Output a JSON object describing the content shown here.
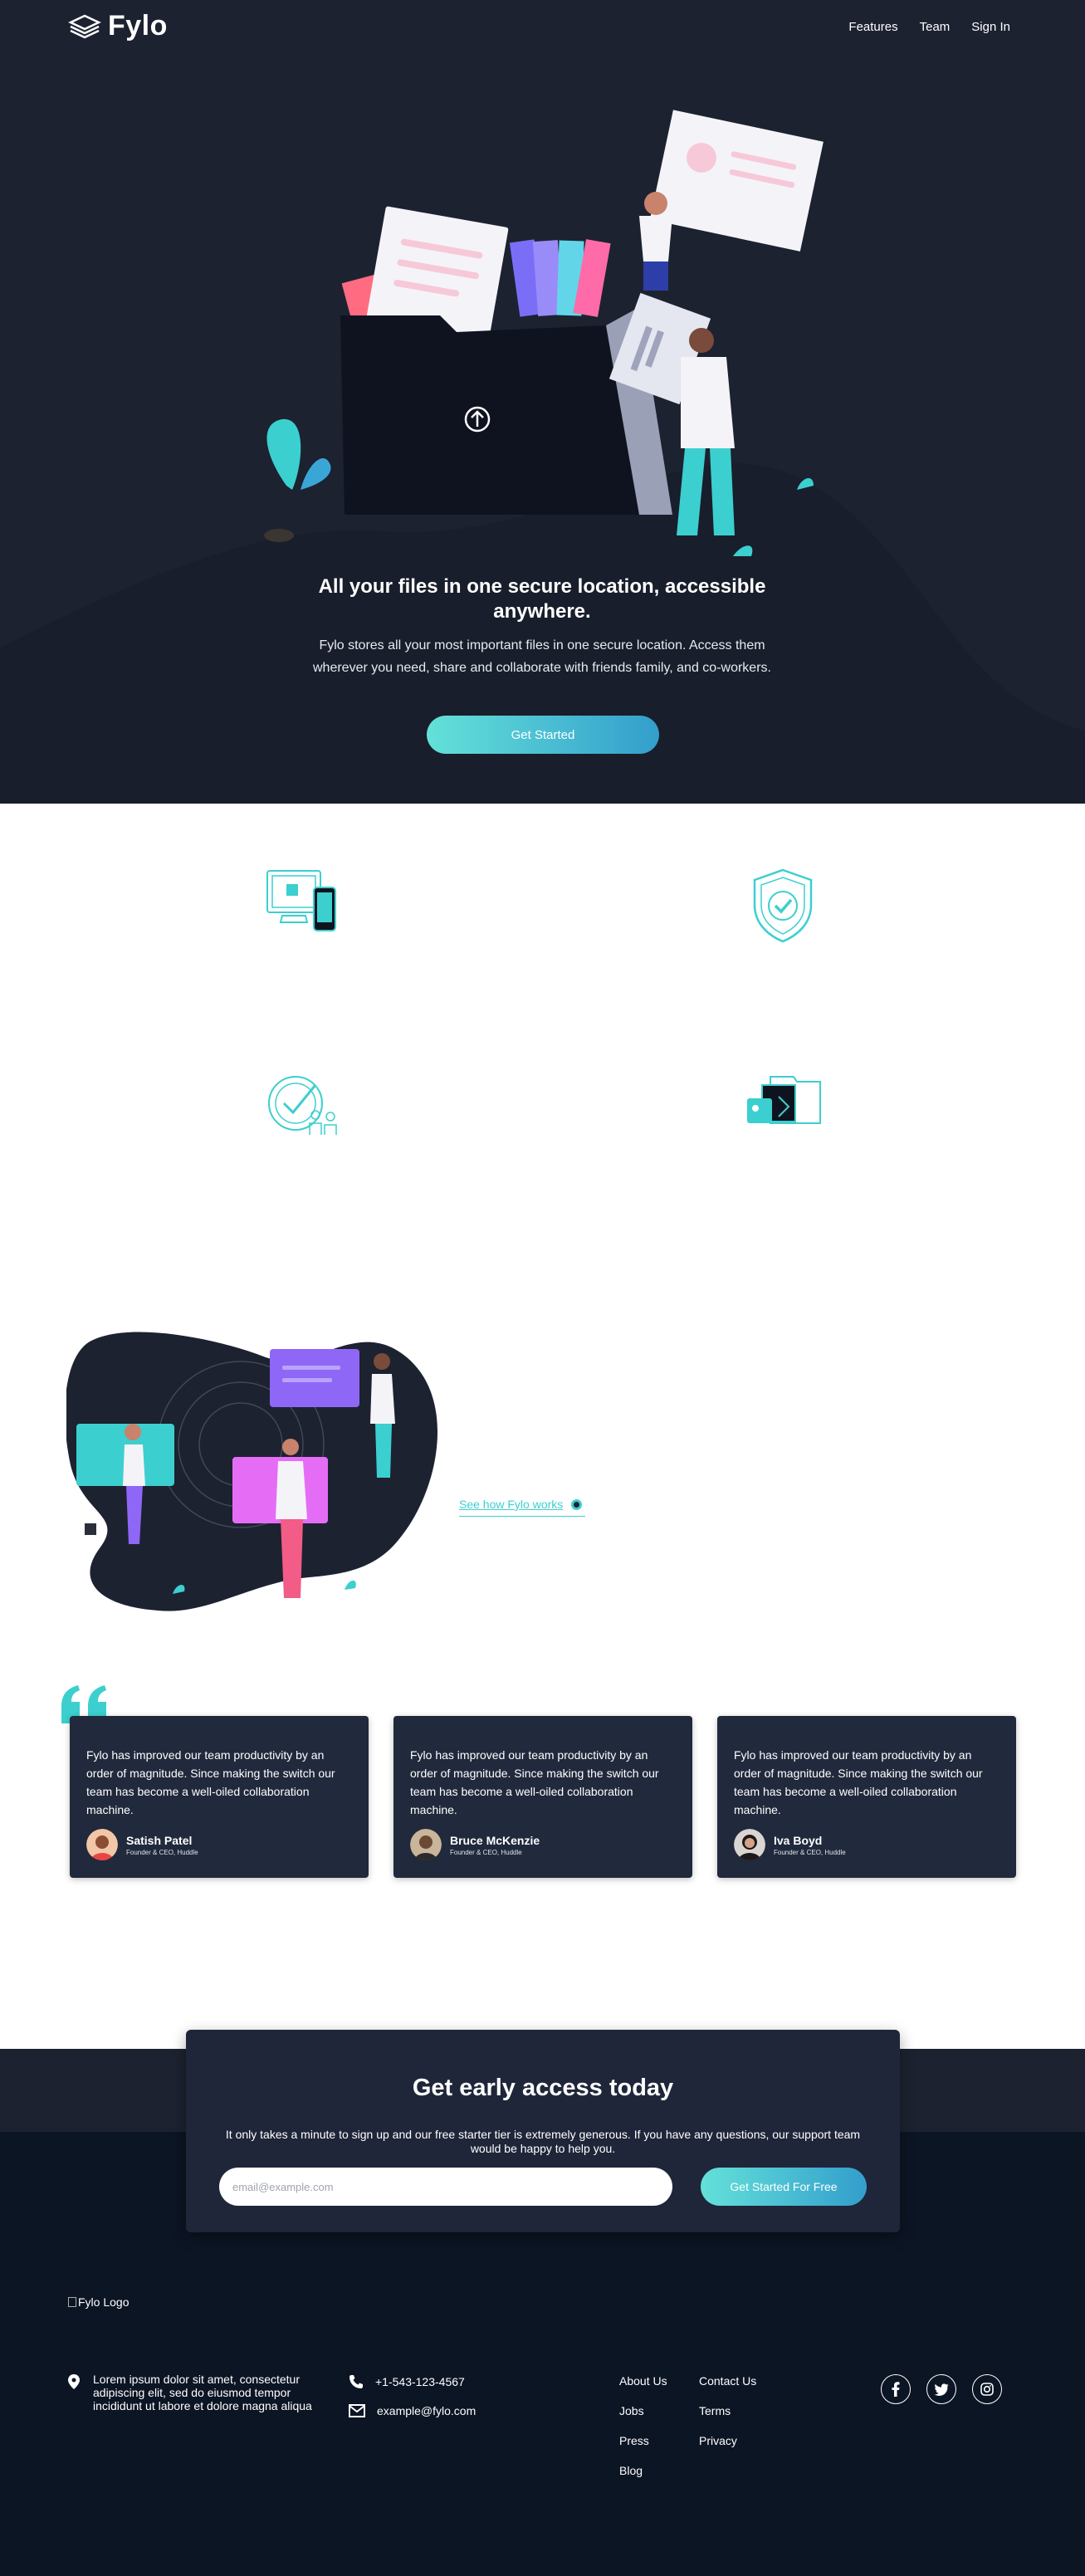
{
  "header": {
    "logo_text": "Fylo",
    "nav": [
      "Features",
      "Team",
      "Sign In"
    ]
  },
  "hero": {
    "title": "All your files in one secure location, accessible anywhere.",
    "text": "Fylo stores all your most important files in one secure location. Access them wherever you need, share and collaborate with friends family, and co-workers.",
    "cta_label": "Get Started"
  },
  "features": [
    {
      "icon": "access-anywhere-icon"
    },
    {
      "icon": "security-shield-icon"
    },
    {
      "icon": "collaboration-icon"
    },
    {
      "icon": "any-file-icon"
    }
  ],
  "productive": {
    "link_label": "See how Fylo works"
  },
  "testimonials": [
    {
      "text": "Fylo has improved our team productivity by an order of magnitude. Since making the switch our team has become a well-oiled collaboration machine.",
      "name": "Satish Patel",
      "role": "Founder & CEO, Huddle"
    },
    {
      "text": "Fylo has improved our team productivity by an order of magnitude. Since making the switch our team has become a well-oiled collaboration machine.",
      "name": "Bruce McKenzie",
      "role": "Founder & CEO, Huddle"
    },
    {
      "text": "Fylo has improved our team productivity by an order of magnitude. Since making the switch our team has become a well-oiled collaboration machine.",
      "name": "Iva Boyd",
      "role": "Founder & CEO, Huddle"
    }
  ],
  "cta": {
    "title": "Get early access today",
    "text": "It only takes a minute to sign up and our free starter tier is extremely generous. If you have any questions, our support team would be happy to help you.",
    "email_placeholder": "email@example.com",
    "button_label": "Get Started For Free"
  },
  "footer": {
    "logo_alt": "Fylo Logo",
    "address": "Lorem ipsum dolor sit amet, consectetur adipiscing elit, sed do eiusmod tempor incididunt ut labore et dolore magna aliqua",
    "phone": "+1-543-123-4567",
    "email": "example@fylo.com",
    "links_col1": [
      "About Us",
      "Jobs",
      "Press",
      "Blog"
    ],
    "links_col2": [
      "Contact Us",
      "Terms",
      "Privacy"
    ],
    "social": [
      "facebook-icon",
      "twitter-icon",
      "instagram-icon"
    ]
  },
  "colors": {
    "hero_bg": "#1c2230",
    "footer_bg": "#0c1524",
    "card_bg": "#21293c",
    "accent_cyan": "#64e1d9",
    "accent_blue": "#339ecc"
  }
}
